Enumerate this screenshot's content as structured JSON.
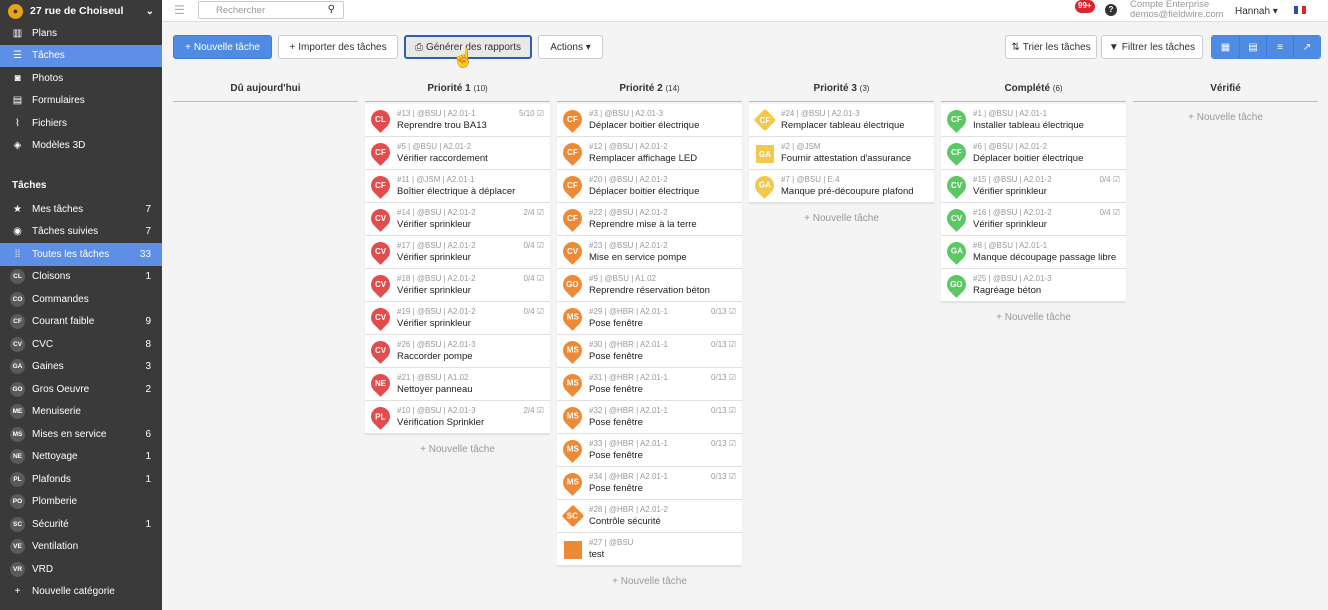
{
  "sidebar": {
    "project": "27 rue de Choiseul",
    "nav": [
      {
        "label": "Plans",
        "icon": "plans-icon"
      },
      {
        "label": "Tâches",
        "icon": "list-icon"
      },
      {
        "label": "Photos",
        "icon": "camera-icon"
      },
      {
        "label": "Formulaires",
        "icon": "form-icon"
      },
      {
        "label": "Fichiers",
        "icon": "paperclip-icon"
      },
      {
        "label": "Modèles 3D",
        "icon": "cube-icon"
      }
    ],
    "section": "Tâches",
    "filters": [
      {
        "label": "Mes tâches",
        "count": "7",
        "icon": "star-icon"
      },
      {
        "label": "Tâches suivies",
        "count": "7",
        "icon": "eye-icon"
      },
      {
        "label": "Toutes les tâches",
        "count": "33",
        "icon": "grid-icon"
      }
    ],
    "categories": [
      {
        "code": "CL",
        "label": "Cloisons",
        "count": "1"
      },
      {
        "code": "CO",
        "label": "Commandes",
        "count": ""
      },
      {
        "code": "CF",
        "label": "Courant faible",
        "count": "9"
      },
      {
        "code": "CV",
        "label": "CVC",
        "count": "8"
      },
      {
        "code": "GA",
        "label": "Gaines",
        "count": "3"
      },
      {
        "code": "GO",
        "label": "Gros Oeuvre",
        "count": "2"
      },
      {
        "code": "ME",
        "label": "Menuiserie",
        "count": ""
      },
      {
        "code": "MS",
        "label": "Mises en service",
        "count": "6"
      },
      {
        "code": "NE",
        "label": "Nettoyage",
        "count": "1"
      },
      {
        "code": "PL",
        "label": "Plafonds",
        "count": "1"
      },
      {
        "code": "PO",
        "label": "Plomberie",
        "count": ""
      },
      {
        "code": "SC",
        "label": "Sécurité",
        "count": "1"
      },
      {
        "code": "VE",
        "label": "Ventilation",
        "count": ""
      },
      {
        "code": "VR",
        "label": "VRD",
        "count": ""
      }
    ],
    "new_category": "Nouvelle catégorie"
  },
  "topbar": {
    "search_placeholder": "Rechercher",
    "notif": "99+",
    "account_line1": "Compte Enterprise",
    "account_line2": "demos@fieldwire.com",
    "user": "Hannah ▾"
  },
  "toolbar": {
    "new_task": "Nouvelle tâche",
    "import": "Importer des tâches",
    "reports": "Générer des rapports",
    "actions": "Actions ▾",
    "sort": "Trier les tâches",
    "filter": "Filtrer les tâches"
  },
  "new_task_link": "+ Nouvelle tâche",
  "colors": {
    "red": "#e34c4c",
    "orange": "#ee8a35",
    "yellow": "#f2c94c",
    "green": "#5cc864",
    "accent": "#4f8be3"
  },
  "columns": [
    {
      "title": "Dû aujourd'hui",
      "count": "",
      "cards": []
    },
    {
      "title": "Priorité 1",
      "count": "(10)",
      "cards": [
        {
          "code": "CL",
          "meta": "#13 | @BSU | A2.01-1",
          "title": "Reprendre trou BA13",
          "prog": "5/10 ☑",
          "color": "red",
          "shape": "pin"
        },
        {
          "code": "CF",
          "meta": "#5 | @BSU | A2.01-2",
          "title": "Vérifier raccordement",
          "prog": "",
          "color": "red",
          "shape": "pin"
        },
        {
          "code": "CF",
          "meta": "#11 | @JSM | A2.01-1",
          "title": "Boîtier électrique à déplacer",
          "prog": "",
          "color": "red",
          "shape": "pin"
        },
        {
          "code": "CV",
          "meta": "#14 | @BSU | A2.01-2",
          "title": "Vérifier sprinkleur",
          "prog": "2/4 ☑",
          "color": "red",
          "shape": "pin"
        },
        {
          "code": "CV",
          "meta": "#17 | @BSU | A2.01-2",
          "title": "Vérifier sprinkleur",
          "prog": "0/4 ☑",
          "color": "red",
          "shape": "pin"
        },
        {
          "code": "CV",
          "meta": "#18 | @BSU | A2.01-2",
          "title": "Vérifier sprinkleur",
          "prog": "0/4 ☑",
          "color": "red",
          "shape": "pin"
        },
        {
          "code": "CV",
          "meta": "#19 | @BSU | A2.01-2",
          "title": "Vérifier sprinkleur",
          "prog": "0/4 ☑",
          "color": "red",
          "shape": "pin"
        },
        {
          "code": "CV",
          "meta": "#26 | @BSU | A2.01-3",
          "title": "Raccorder pompe",
          "prog": "",
          "color": "red",
          "shape": "pin"
        },
        {
          "code": "NE",
          "meta": "#21 | @BSU | A1.02",
          "title": "Nettoyer panneau",
          "prog": "",
          "color": "red",
          "shape": "pin"
        },
        {
          "code": "PL",
          "meta": "#10 | @BSU | A2.01-3",
          "title": "Vérification Sprinkler",
          "prog": "2/4 ☑",
          "color": "red",
          "shape": "pin"
        }
      ]
    },
    {
      "title": "Priorité 2",
      "count": "(14)",
      "cards": [
        {
          "code": "CF",
          "meta": "#3 | @BSU | A2.01-3",
          "title": "Déplacer boitier électrique",
          "prog": "",
          "color": "orange",
          "shape": "pin"
        },
        {
          "code": "CF",
          "meta": "#12 | @BSU | A2.01-2",
          "title": "Remplacer affichage LED",
          "prog": "",
          "color": "orange",
          "shape": "pin"
        },
        {
          "code": "CF",
          "meta": "#20 | @BSU | A2.01-2",
          "title": "Déplacer boitier électrique",
          "prog": "",
          "color": "orange",
          "shape": "pin"
        },
        {
          "code": "CF",
          "meta": "#22 | @BSU | A2.01-2",
          "title": "Reprendre mise à la terre",
          "prog": "",
          "color": "orange",
          "shape": "pin"
        },
        {
          "code": "CV",
          "meta": "#23 | @BSU | A2.01-2",
          "title": "Mise en service pompe",
          "prog": "",
          "color": "orange",
          "shape": "pin"
        },
        {
          "code": "GO",
          "meta": "#9 | @BSU | A1.02",
          "title": "Reprendre réservation béton",
          "prog": "",
          "color": "orange",
          "shape": "pin"
        },
        {
          "code": "MS",
          "meta": "#29 | @HBR | A2.01-1",
          "title": "Pose fenêtre",
          "prog": "0/13 ☑",
          "color": "orange",
          "shape": "pin"
        },
        {
          "code": "MS",
          "meta": "#30 | @HBR | A2.01-1",
          "title": "Pose fenêtre",
          "prog": "0/13 ☑",
          "color": "orange",
          "shape": "pin"
        },
        {
          "code": "MS",
          "meta": "#31 | @HBR | A2.01-1",
          "title": "Pose fenêtre",
          "prog": "0/13 ☑",
          "color": "orange",
          "shape": "pin"
        },
        {
          "code": "MS",
          "meta": "#32 | @HBR | A2.01-1",
          "title": "Pose fenêtre",
          "prog": "0/13 ☑",
          "color": "orange",
          "shape": "pin"
        },
        {
          "code": "MS",
          "meta": "#33 | @HBR | A2.01-1",
          "title": "Pose fenêtre",
          "prog": "0/13 ☑",
          "color": "orange",
          "shape": "pin"
        },
        {
          "code": "MS",
          "meta": "#34 | @HBR | A2.01-1",
          "title": "Pose fenêtre",
          "prog": "0/13 ☑",
          "color": "orange",
          "shape": "pin"
        },
        {
          "code": "SC",
          "meta": "#28 | @HBR | A2.01-2",
          "title": "Contrôle sécurité",
          "prog": "",
          "color": "orange",
          "shape": "dia"
        },
        {
          "code": "",
          "meta": "#27 | @BSU",
          "title": "test",
          "prog": "",
          "color": "orange",
          "shape": "sq"
        }
      ]
    },
    {
      "title": "Priorité 3",
      "count": "(3)",
      "cards": [
        {
          "code": "CF",
          "meta": "#24 | @BSU | A2.01-3",
          "title": "Remplacer tableau électrique",
          "prog": "",
          "color": "yellow",
          "shape": "dia"
        },
        {
          "code": "GA",
          "meta": "#2 | @JSM",
          "title": "Fournir attestation d'assurance",
          "prog": "",
          "color": "yellow",
          "shape": "sq"
        },
        {
          "code": "GA",
          "meta": "#7 | @BSU | E.4",
          "title": "Manque pré-découpure plafond",
          "prog": "",
          "color": "yellow",
          "shape": "pin"
        }
      ]
    },
    {
      "title": "Complété",
      "count": "(6)",
      "cards": [
        {
          "code": "CF",
          "meta": "#1 | @BSU | A2.01-1",
          "title": "Installer tableau électrique",
          "prog": "",
          "color": "green",
          "shape": "pin"
        },
        {
          "code": "CF",
          "meta": "#6 | @BSU | A2.01-2",
          "title": "Déplacer boitier électrique",
          "prog": "",
          "color": "green",
          "shape": "pin"
        },
        {
          "code": "CV",
          "meta": "#15 | @BSU | A2.01-2",
          "title": "Vérifier sprinkleur",
          "prog": "0/4 ☑",
          "color": "green",
          "shape": "pin"
        },
        {
          "code": "CV",
          "meta": "#16 | @BSU | A2.01-2",
          "title": "Vérifier sprinkleur",
          "prog": "0/4 ☑",
          "color": "green",
          "shape": "pin"
        },
        {
          "code": "GA",
          "meta": "#8 | @BSU | A2.01-1",
          "title": "Manque découpage passage libre",
          "prog": "",
          "color": "green",
          "shape": "pin"
        },
        {
          "code": "GO",
          "meta": "#25 | @BSU | A2.01-3",
          "title": "Ragréage béton",
          "prog": "",
          "color": "green",
          "shape": "pin"
        }
      ]
    },
    {
      "title": "Vérifié",
      "count": "",
      "cards": []
    }
  ]
}
